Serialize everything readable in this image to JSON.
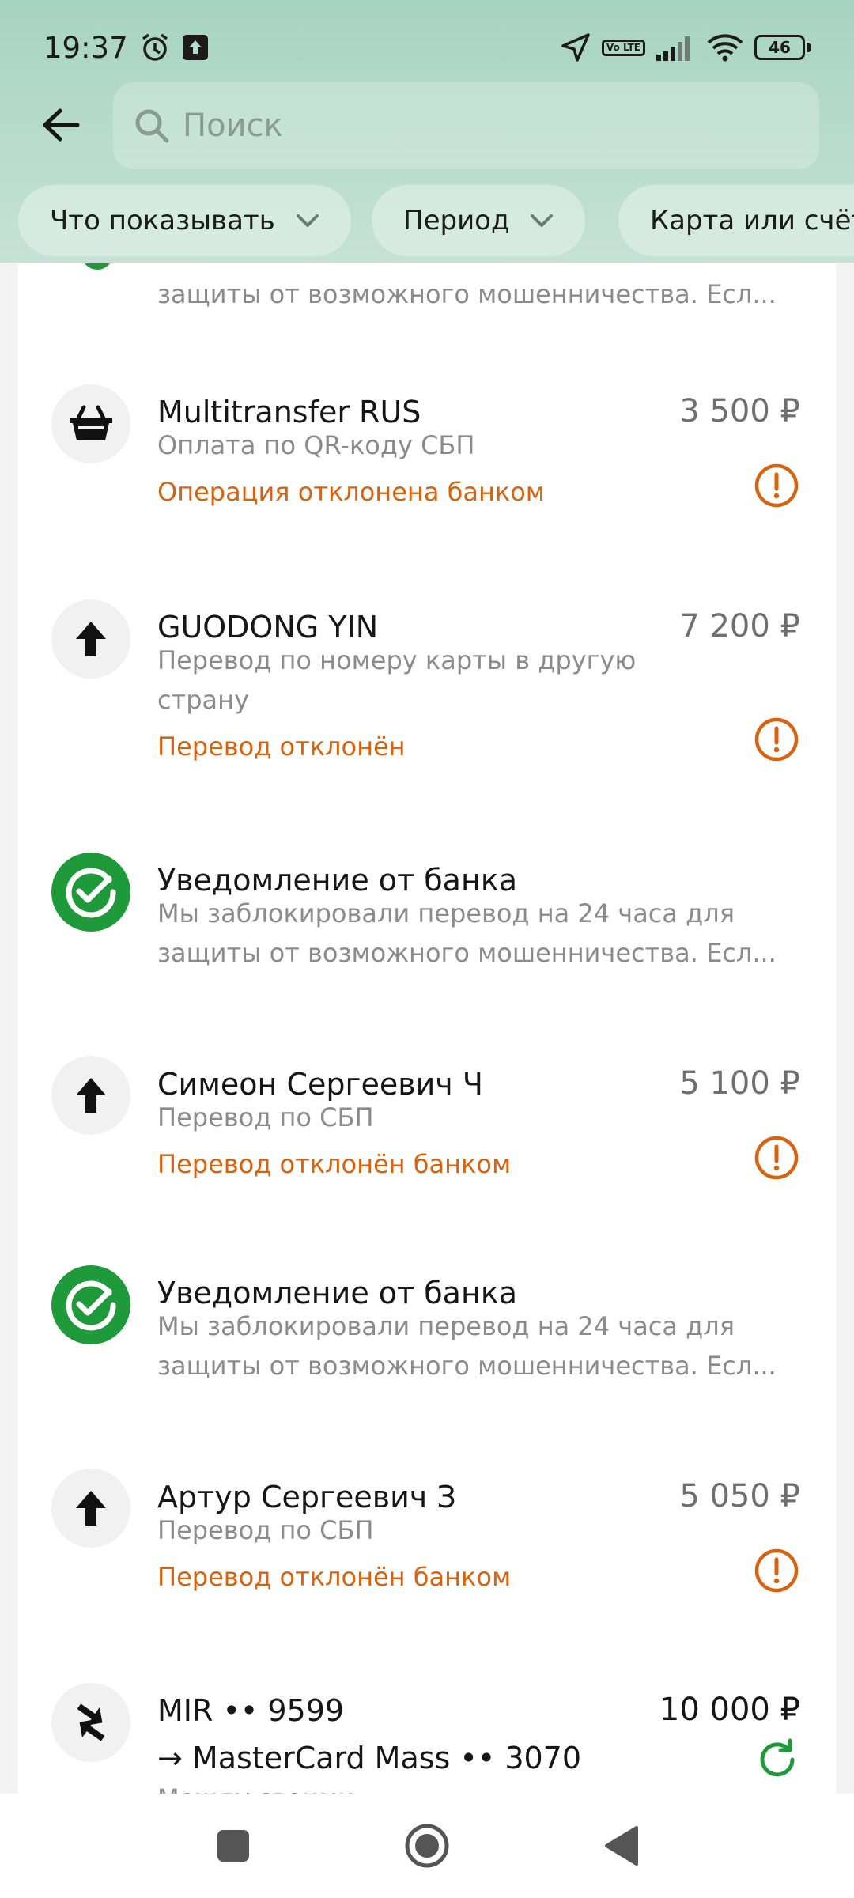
{
  "status_bar": {
    "time": "19:37",
    "battery": "46",
    "volte": "Vo LTE"
  },
  "search": {
    "placeholder": "Поиск"
  },
  "filters": [
    {
      "label": "Что показывать"
    },
    {
      "label": "Период"
    },
    {
      "label": "Карта или счёт"
    }
  ],
  "transactions": [
    {
      "type": "notification",
      "text": "защиты от возможного мошенничества. Есл..."
    },
    {
      "title": "Multitransfer RUS",
      "amount": "3 500 ₽",
      "description": "Оплата по QR-коду СБП",
      "status": "Операция отклонена банком",
      "icon": "shopping-basket-icon"
    },
    {
      "title": "GUODONG YIN",
      "amount": "7 200 ₽",
      "description": "Перевод по номеру карты в другую страну",
      "status": "Перевод отклонён",
      "icon": "arrow-up-icon"
    },
    {
      "title": "Уведомление от банка",
      "description": "Мы заблокировали перевод на 24 часа для защиты от возможного мошенничества. Есл...",
      "icon": "bank-logo-icon"
    },
    {
      "title": "Симеон Сергеевич Ч",
      "amount": "5 100 ₽",
      "description": "Перевод по СБП",
      "status": "Перевод отклонён банком",
      "icon": "arrow-up-icon"
    },
    {
      "title": "Уведомление от банка",
      "description": "Мы заблокировали перевод на 24 часа для защиты от возможного мошенничества. Есл...",
      "icon": "bank-logo-icon"
    },
    {
      "title": "Артур Сергеевич З",
      "amount": "5 050 ₽",
      "description": "Перевод по СБП",
      "status": "Перевод отклонён банком",
      "icon": "arrow-up-icon"
    },
    {
      "title": "MIR •• 9599",
      "title2": "→ MasterCard Mass •• 3070",
      "amount": "10 000 ₽",
      "description": "Между своими",
      "icon": "transfer-arrows-icon"
    }
  ],
  "colors": {
    "accent_green": "#1f9a3a",
    "status_orange": "#d9620f",
    "header_gradient": "#a7d3c3"
  }
}
